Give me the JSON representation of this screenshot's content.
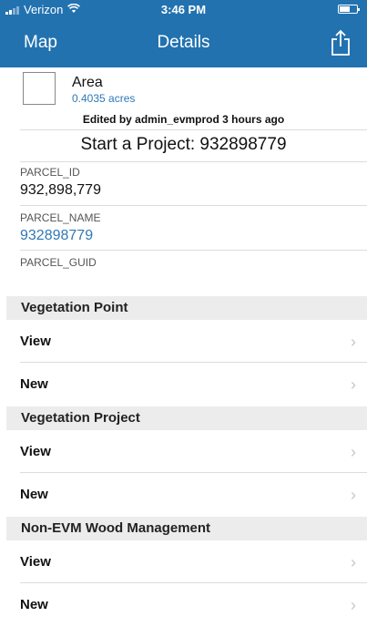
{
  "status_bar": {
    "carrier": "Verizon",
    "time": "3:46 PM"
  },
  "nav": {
    "back_label": "Map",
    "title": "Details"
  },
  "header": {
    "area_label": "Area",
    "area_value": "0.4035 acres",
    "edited_text": "Edited by admin_evmprod 3 hours ago",
    "project_title": "Start a Project: 932898779"
  },
  "fields": [
    {
      "label": "PARCEL_ID",
      "value": "932,898,779"
    },
    {
      "label": "PARCEL_NAME",
      "value": "932898779"
    },
    {
      "label": "PARCEL_GUID",
      "value": ""
    }
  ],
  "sections": [
    {
      "title": "Vegetation Point",
      "rows": [
        {
          "label": "View"
        },
        {
          "label": "New"
        }
      ]
    },
    {
      "title": "Vegetation Project",
      "rows": [
        {
          "label": "View"
        },
        {
          "label": "New"
        }
      ]
    },
    {
      "title": "Non-EVM Wood Management",
      "rows": [
        {
          "label": "View"
        },
        {
          "label": "New"
        }
      ]
    }
  ],
  "icons": {
    "share": "share-icon",
    "wifi": "wifi-icon",
    "battery": "battery-icon",
    "chevron": "chevron-right-icon",
    "signal": "signal-icon"
  },
  "colors": {
    "nav_background": "#2272b0",
    "link_blue": "#2f78b6",
    "section_background": "#ececec"
  }
}
